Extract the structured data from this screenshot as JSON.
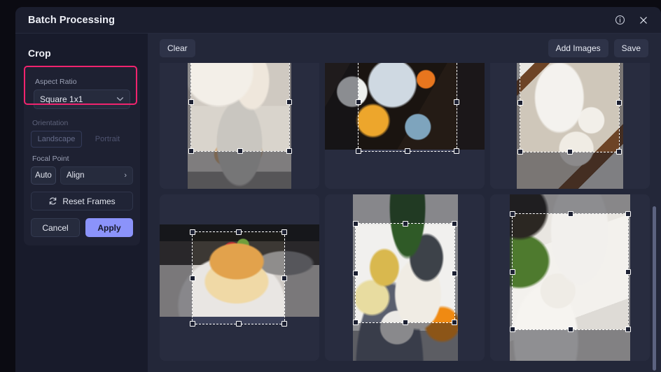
{
  "window": {
    "title": "Batch Processing",
    "info_icon": "info-circle-icon",
    "close_icon": "close-icon"
  },
  "sidebar": {
    "section_title": "Crop",
    "aspect_ratio": {
      "label": "Aspect Ratio",
      "value": "Square 1x1",
      "chevron": "⌄",
      "highlight_color": "#f0246e"
    },
    "orientation": {
      "label": "Orientation",
      "options": [
        "Landscape",
        "Portrait"
      ],
      "selected": "Landscape",
      "disabled": true
    },
    "focal_point": {
      "label": "Focal Point",
      "auto_label": "Auto",
      "align_label": "Align",
      "align_arrow": "›"
    },
    "reset_label": "Reset Frames",
    "reset_icon": "refresh-icon",
    "cancel_label": "Cancel",
    "apply_label": "Apply",
    "apply_color": "#8b93fa"
  },
  "toolbar": {
    "clear_label": "Clear",
    "add_images_label": "Add Images",
    "save_label": "Save"
  },
  "grid": {
    "tiles": [
      {
        "name": "scones-and-tea",
        "alt": "Plate of scones with a floral teacup"
      },
      {
        "name": "brunch-flatlay",
        "alt": "Dark flatlay brunch spread with latte"
      },
      {
        "name": "croissant-tray",
        "alt": "Breakfast tray with croissant, juice and cereal"
      },
      {
        "name": "pancake-stack",
        "alt": "Stack of pancakes with strawberry and caramel"
      },
      {
        "name": "breakfast-table",
        "alt": "White table with waffles, croissants and eggs"
      },
      {
        "name": "salad-plate",
        "alt": "Marble table with salad plate and coffee cup"
      }
    ]
  },
  "scrollbar": {
    "orientation": "vertical"
  }
}
